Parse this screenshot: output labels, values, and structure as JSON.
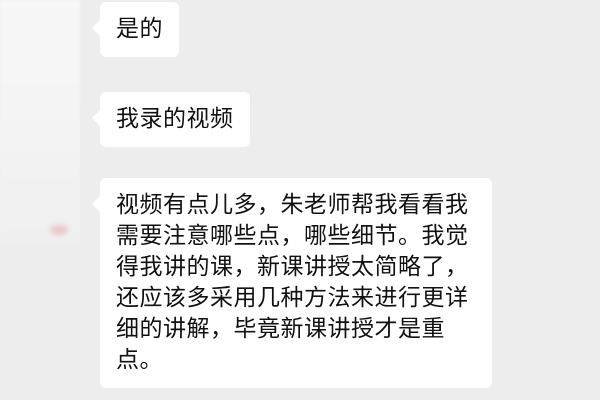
{
  "messages": [
    {
      "text": "是的"
    },
    {
      "text": "我录的视频"
    },
    {
      "text": "视频有点儿多，朱老师帮我看看我需要注意哪些点，哪些细节。我觉得我讲的课，新课讲授太简略了，还应该多采用几种方法来进行更详细的讲解，毕竟新课讲授才是重点。"
    }
  ],
  "colors": {
    "background": "#ededed",
    "bubble": "#ffffff",
    "text": "#111111"
  }
}
